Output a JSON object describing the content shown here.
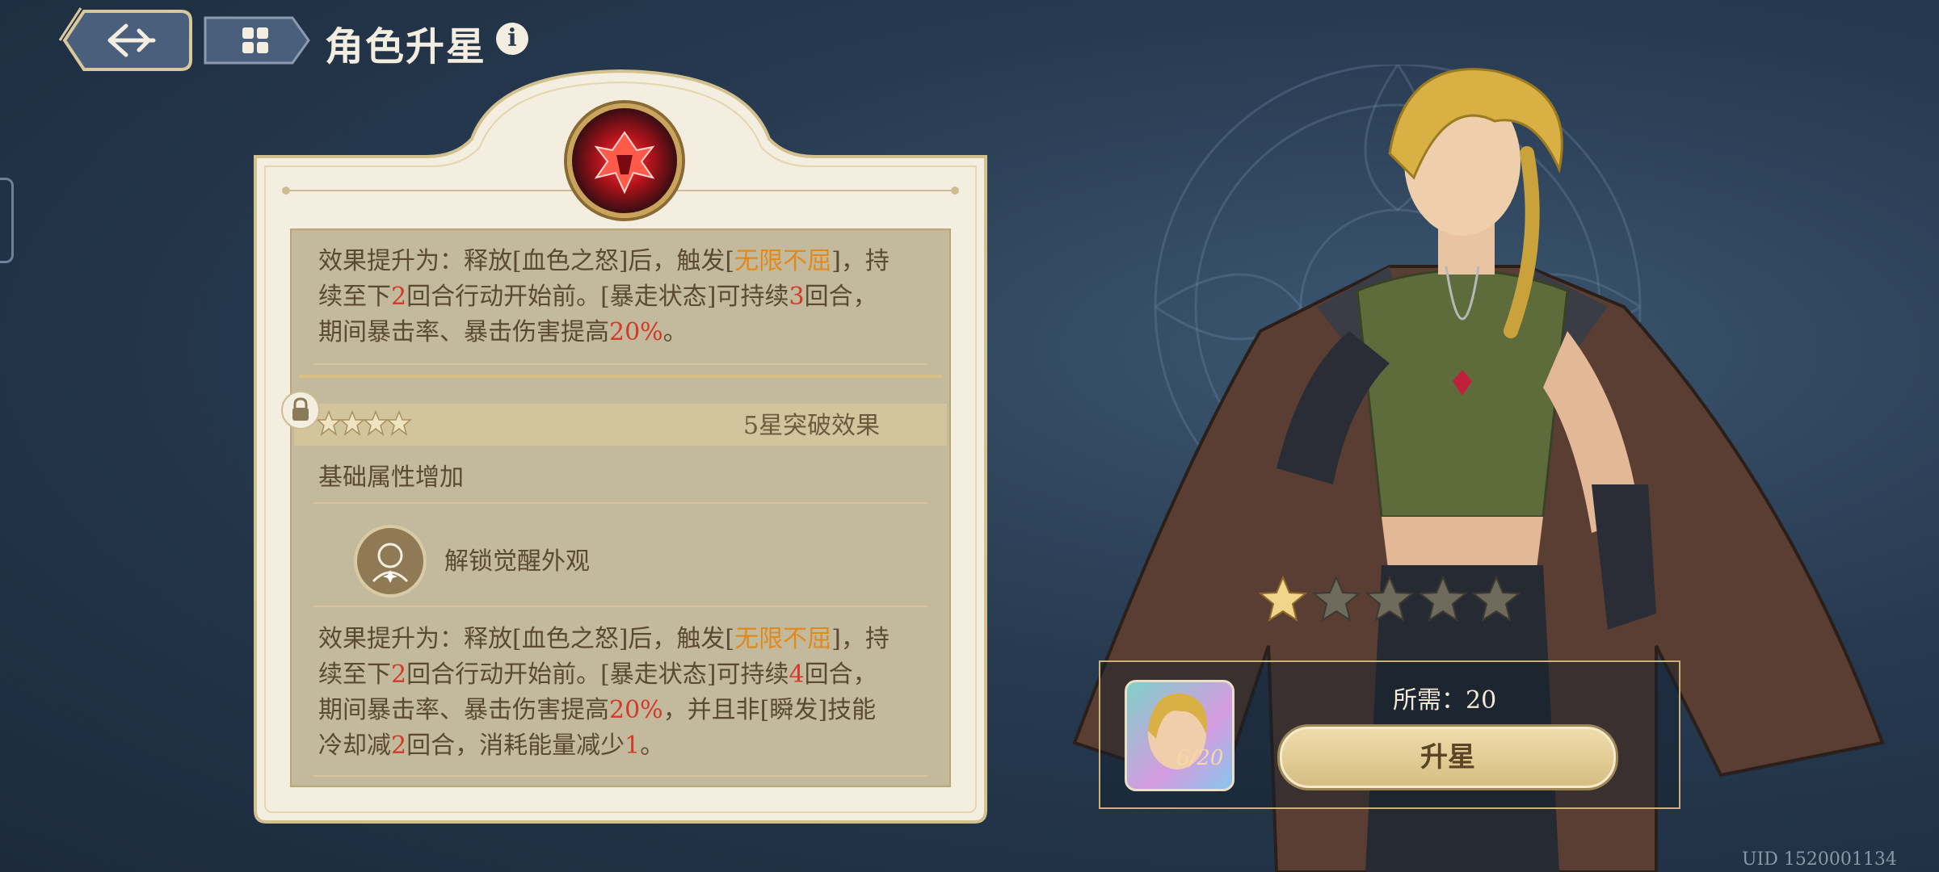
{
  "header": {
    "title": "角色升星",
    "info_symbol": "i"
  },
  "panel": {
    "effect_upper": {
      "line1_pre": "效果提升为：释放[血色之怒]后，触发[",
      "line1_hl": "无限不屈",
      "line1_post": "]，持",
      "line2_pre": "续至下",
      "line2_n1": "2",
      "line2_mid": "回合行动开始前。[暴走状态]可持续",
      "line2_n2": "3",
      "line2_post": "回合，",
      "line3_pre": "期间暴击率、暴击伤害提高",
      "line3_pct": "20%",
      "line3_post": "。"
    },
    "star_section": {
      "small_stars": 4,
      "label": "5星突破效果"
    },
    "basic_attr": "基础属性增加",
    "unlock_label": "解锁觉醒外观",
    "effect_lower": {
      "line1_pre": "效果提升为：释放[血色之怒]后，触发[",
      "line1_hl": "无限不屈",
      "line1_post": "]，持",
      "line2_pre": "续至下",
      "line2_n1": "2",
      "line2_mid": "回合行动开始前。[暴走状态]可持续",
      "line2_n2": "4",
      "line2_post": "回合，",
      "line3_pre": "期间暴击率、暴击伤害提高",
      "line3_pct": "20%",
      "line3_post": "，并且非[瞬发]技能",
      "line4_pre": "冷却减",
      "line4_n1": "2",
      "line4_mid": "回合，消耗能量减少",
      "line4_n2": "1",
      "line4_post": "。"
    }
  },
  "stars": {
    "filled": 1,
    "total": 5
  },
  "upgrade": {
    "item_count": "6/20",
    "need_label": "所需：20",
    "button_label": "升星"
  },
  "footer": {
    "uid": "UID 1520001134"
  },
  "colors": {
    "highlight_orange": "#e08a1e",
    "highlight_red": "#d23a2a",
    "panel_bg": "#f3eedf",
    "accent_gold": "#c9a45a"
  }
}
